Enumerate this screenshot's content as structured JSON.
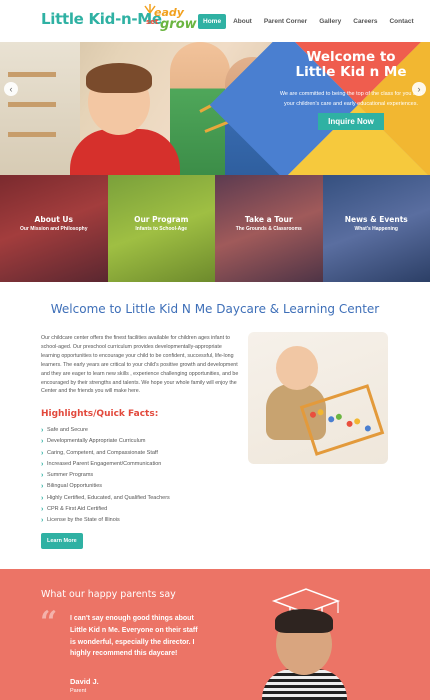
{
  "header": {
    "logo_text": "Little Kid-n-Me",
    "badge": {
      "line1": "eady",
      "line2": "set",
      "line3": "grow"
    },
    "nav": [
      {
        "label": "Home",
        "active": true
      },
      {
        "label": "About",
        "active": false
      },
      {
        "label": "Parent Corner",
        "active": false
      },
      {
        "label": "Gallery",
        "active": false
      },
      {
        "label": "Careers",
        "active": false
      },
      {
        "label": "Contact",
        "active": false
      }
    ]
  },
  "hero": {
    "title_line1": "Welcome to",
    "title_line2": "Little Kid n Me",
    "subtitle": "We are committed to being the top of the class for you and your children's care and early educational experiences.",
    "button_label": "Inquire Now",
    "prev_icon": "‹",
    "next_icon": "›"
  },
  "tiles": [
    {
      "title": "About Us",
      "subtitle": "Our Mission and Philosophy"
    },
    {
      "title": "Our Program",
      "subtitle": "Infants to School-Age"
    },
    {
      "title": "Take a Tour",
      "subtitle": "The Grounds & Classrooms"
    },
    {
      "title": "News & Events",
      "subtitle": "What's Happening"
    }
  ],
  "welcome": {
    "title": "Welcome to Little Kid N Me Daycare & Learning Center",
    "intro": "Our childcare center offers the finest facilities available for children ages infant to school-aged. Our preschool curriculum provides developmentally-appropriate learning opportunities to encourage your child to be confident, successful, life-long learners. The early years are critical to your child's positive growth and development and they are eager to learn new skills , experience challenging opportunities, and be encouraged by their strengths and talents. We hope your whole family will enjoy the Center and the friends you will make here.",
    "highlights_heading": "Highlights/Quick Facts:",
    "facts": [
      "Safe and Secure",
      "Developmentally Appropriate Curriculum",
      "Caring, Competent, and Compassionate Staff",
      "Increased Parent Engagement/Communication",
      "Summer Programs",
      "Bilingual Opportunities",
      "Highly Certified, Educated, and Qualified Teachers",
      "CPR & First Aid Certified",
      "License by the State of Illinois"
    ],
    "button_label": "Learn More"
  },
  "testimonial": {
    "heading": "What our happy parents say",
    "quote_mark": "“",
    "quote": "I can't say enough good things about Little Kid n Me. Everyone on their staff is wonderful, especially the director. I highly recommend this daycare!",
    "name": "David J.",
    "role": "Parent"
  },
  "colors": {
    "brand_teal": "#2fb1a3",
    "heading_blue": "#3e6fb8",
    "highlight_red": "#e2493c",
    "testimonial_bg": "#ec7466"
  }
}
